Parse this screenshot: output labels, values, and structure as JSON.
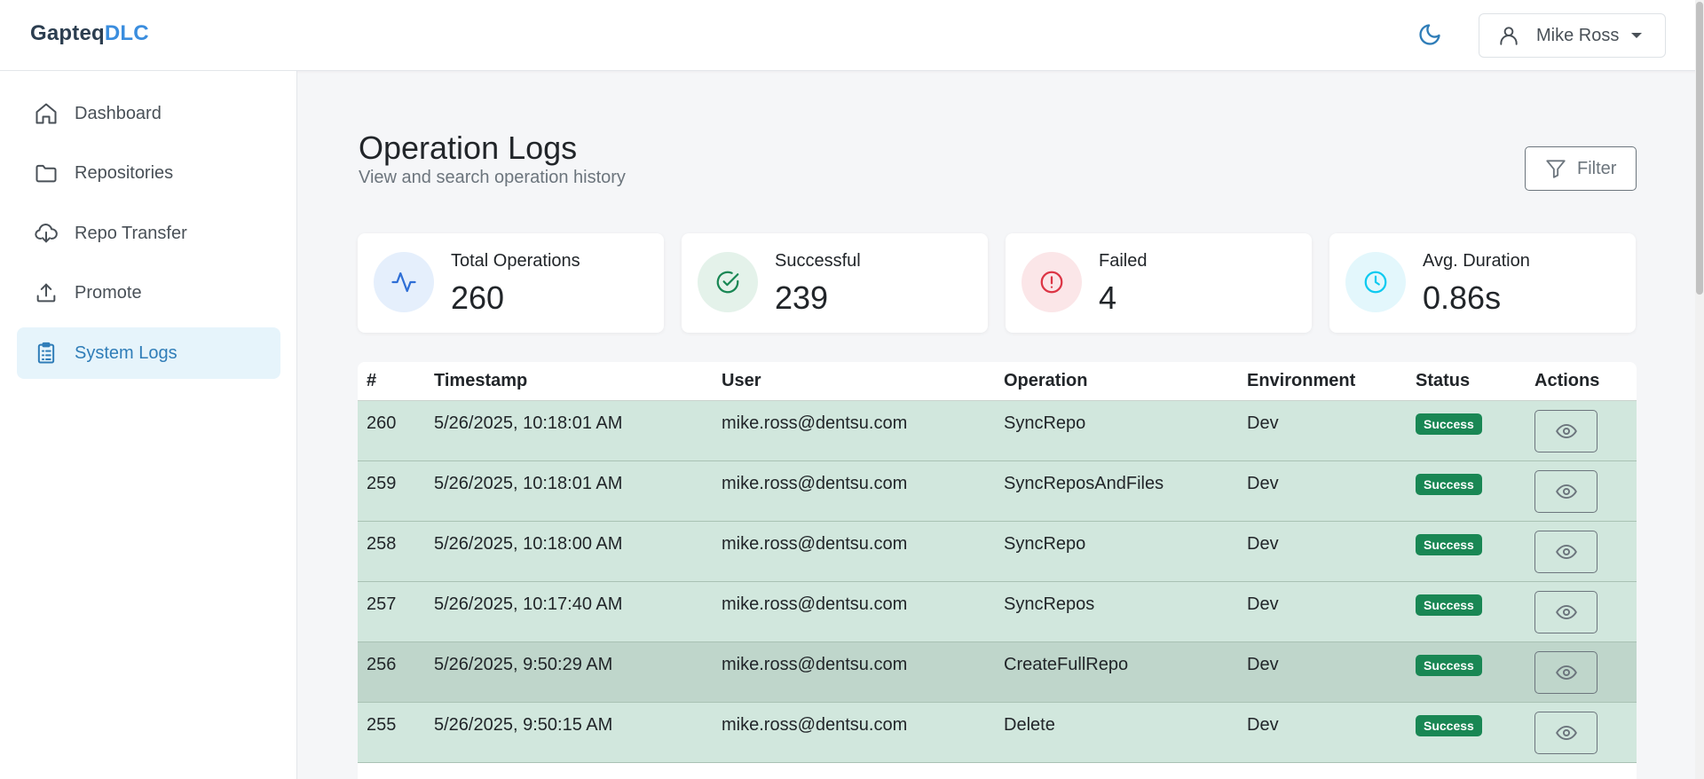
{
  "brand": {
    "name_part1": "Gapteq",
    "name_part2": "DLC"
  },
  "header": {
    "user_name": "Mike Ross",
    "theme_icon": "moon-icon",
    "user_icon": "user-icon"
  },
  "sidebar": {
    "items": [
      {
        "label": "Dashboard",
        "icon": "home-icon",
        "active": false
      },
      {
        "label": "Repositories",
        "icon": "folder-icon",
        "active": false
      },
      {
        "label": "Repo Transfer",
        "icon": "cloud-download-icon",
        "active": false
      },
      {
        "label": "Promote",
        "icon": "upload-icon",
        "active": false
      },
      {
        "label": "System Logs",
        "icon": "clipboard-list-icon",
        "active": true
      }
    ]
  },
  "page": {
    "title": "Operation Logs",
    "subtitle": "View and search operation history",
    "filter_label": "Filter"
  },
  "stats": [
    {
      "label": "Total Operations",
      "value": "260",
      "icon": "activity-icon",
      "color": "#2f6fd6",
      "bg": "#e5effc"
    },
    {
      "label": "Successful",
      "value": "239",
      "icon": "check-circle-icon",
      "color": "#198754",
      "bg": "#e4f2ea"
    },
    {
      "label": "Failed",
      "value": "4",
      "icon": "alert-circle-icon",
      "color": "#dc3545",
      "bg": "#fbe6e8"
    },
    {
      "label": "Avg. Duration",
      "value": "0.86s",
      "icon": "clock-icon",
      "color": "#0dcaf0",
      "bg": "#e3f7fc"
    }
  ],
  "table": {
    "columns": [
      "#",
      "Timestamp",
      "User",
      "Operation",
      "Environment",
      "Status",
      "Actions"
    ],
    "rows": [
      {
        "id": "260",
        "timestamp": "5/26/2025, 10:18:01 AM",
        "user": "mike.ross@dentsu.com",
        "operation": "SyncRepo",
        "environment": "Dev",
        "status": "Success"
      },
      {
        "id": "259",
        "timestamp": "5/26/2025, 10:18:01 AM",
        "user": "mike.ross@dentsu.com",
        "operation": "SyncReposAndFiles",
        "environment": "Dev",
        "status": "Success"
      },
      {
        "id": "258",
        "timestamp": "5/26/2025, 10:18:00 AM",
        "user": "mike.ross@dentsu.com",
        "operation": "SyncRepo",
        "environment": "Dev",
        "status": "Success"
      },
      {
        "id": "257",
        "timestamp": "5/26/2025, 10:17:40 AM",
        "user": "mike.ross@dentsu.com",
        "operation": "SyncRepos",
        "environment": "Dev",
        "status": "Success"
      },
      {
        "id": "256",
        "timestamp": "5/26/2025, 9:50:29 AM",
        "user": "mike.ross@dentsu.com",
        "operation": "CreateFullRepo",
        "environment": "Dev",
        "status": "Success",
        "hover": true
      },
      {
        "id": "255",
        "timestamp": "5/26/2025, 9:50:15 AM",
        "user": "mike.ross@dentsu.com",
        "operation": "Delete",
        "environment": "Dev",
        "status": "Success"
      }
    ]
  },
  "colors": {
    "accent": "#3a8dde",
    "success": "#198754",
    "row_success": "#d1e7dd"
  }
}
